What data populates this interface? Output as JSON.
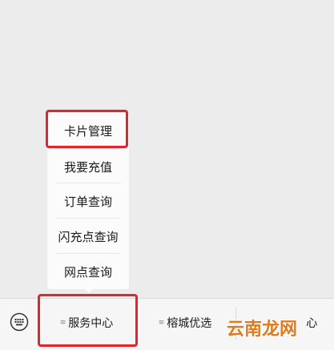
{
  "menu": {
    "items": [
      {
        "label": "卡片管理"
      },
      {
        "label": "我要充值"
      },
      {
        "label": "订单查询"
      },
      {
        "label": "闪充点查询"
      },
      {
        "label": "网点查询"
      }
    ]
  },
  "bottom_bar": {
    "keyboard_icon": "keyboard-icon",
    "tabs": [
      {
        "label": "服务中心",
        "icon": "hamburger-icon"
      },
      {
        "label": "榕城优选",
        "icon": "hamburger-icon"
      },
      {
        "label": "心",
        "icon": "hamburger-icon"
      }
    ]
  },
  "watermark": {
    "text": "云南龙网"
  },
  "colors": {
    "highlight": "#e4232a",
    "watermark": "#e07a1f"
  }
}
